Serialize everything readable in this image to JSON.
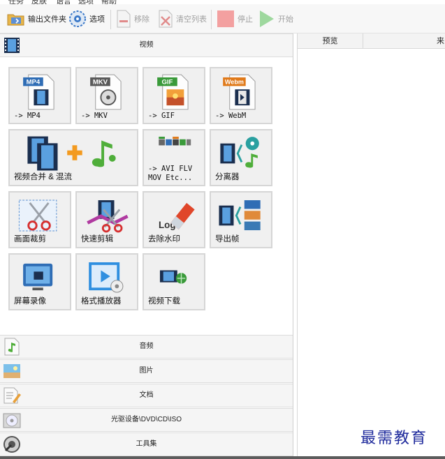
{
  "menu": [
    "任务",
    "皮肤",
    "语言",
    "选项",
    "帮助"
  ],
  "toolbar": {
    "output_folder": "输出文件夹",
    "options": "选项",
    "remove": "移除",
    "clear_list": "清空列表",
    "stop": "停止",
    "start": "开始"
  },
  "categories": {
    "video": "视频",
    "audio": "音频",
    "image": "图片",
    "document": "文档",
    "disc": "光驱设备\\DVD\\CD\\ISO",
    "tools": "工具集"
  },
  "tiles": {
    "mp4": {
      "label": "-> MP4",
      "badge": "MP4"
    },
    "mkv": {
      "label": "-> MKV",
      "badge": "MKV"
    },
    "gif": {
      "label": "-> GIF",
      "badge": "GIF"
    },
    "webm": {
      "label": "-> WebM",
      "badge": "Webm"
    },
    "merge": {
      "label": "视频合并 & 混流"
    },
    "other": {
      "label": "-> AVI FLV\nMOV Etc..."
    },
    "splitter": {
      "label": "分离器"
    },
    "crop": {
      "label": "画面裁剪"
    },
    "quickcut": {
      "label": "快速剪辑"
    },
    "watermark_remove": {
      "label": "去除水印",
      "logo_text": "Logo"
    },
    "export_frames": {
      "label": "导出帧"
    },
    "screen_record": {
      "label": "屏幕录像"
    },
    "player": {
      "label": "格式播放器"
    },
    "download": {
      "label": "视频下载"
    }
  },
  "file_list": {
    "columns": [
      "预览",
      "来"
    ]
  },
  "watermark_text": "最需教育",
  "colors": {
    "accent_green": "#4caf50",
    "stop_red": "#f08080",
    "tile_bg": "#f0f0f0",
    "watermark_blue": "#1e2a9c"
  }
}
